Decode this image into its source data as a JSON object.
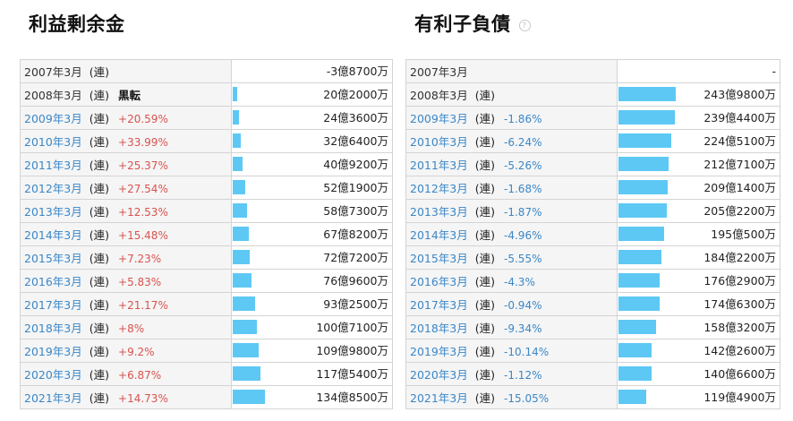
{
  "left": {
    "title": "利益剰余金",
    "rows": [
      {
        "period": "2007年3月",
        "cons": "(連)",
        "change": "",
        "change_dir": "",
        "value": "-3億8700万",
        "amount": -3.87
      },
      {
        "period": "2008年3月",
        "cons": "(連)",
        "change": "黒転",
        "change_dir": "bold",
        "value": "20億2000万",
        "amount": 20.2
      },
      {
        "period": "2009年3月",
        "cons": "(連)",
        "change": "+20.59%",
        "change_dir": "up",
        "value": "24億3600万",
        "amount": 24.36
      },
      {
        "period": "2010年3月",
        "cons": "(連)",
        "change": "+33.99%",
        "change_dir": "up",
        "value": "32億6400万",
        "amount": 32.64
      },
      {
        "period": "2011年3月",
        "cons": "(連)",
        "change": "+25.37%",
        "change_dir": "up",
        "value": "40億9200万",
        "amount": 40.92
      },
      {
        "period": "2012年3月",
        "cons": "(連)",
        "change": "+27.54%",
        "change_dir": "up",
        "value": "52億1900万",
        "amount": 52.19
      },
      {
        "period": "2013年3月",
        "cons": "(連)",
        "change": "+12.53%",
        "change_dir": "up",
        "value": "58億7300万",
        "amount": 58.73
      },
      {
        "period": "2014年3月",
        "cons": "(連)",
        "change": "+15.48%",
        "change_dir": "up",
        "value": "67億8200万",
        "amount": 67.82
      },
      {
        "period": "2015年3月",
        "cons": "(連)",
        "change": "+7.23%",
        "change_dir": "up",
        "value": "72億7200万",
        "amount": 72.72
      },
      {
        "period": "2016年3月",
        "cons": "(連)",
        "change": "+5.83%",
        "change_dir": "up",
        "value": "76億9600万",
        "amount": 76.96
      },
      {
        "period": "2017年3月",
        "cons": "(連)",
        "change": "+21.17%",
        "change_dir": "up",
        "value": "93億2500万",
        "amount": 93.25
      },
      {
        "period": "2018年3月",
        "cons": "(連)",
        "change": "+8%",
        "change_dir": "up",
        "value": "100億7100万",
        "amount": 100.71
      },
      {
        "period": "2019年3月",
        "cons": "(連)",
        "change": "+9.2%",
        "change_dir": "up",
        "value": "109億9800万",
        "amount": 109.98
      },
      {
        "period": "2020年3月",
        "cons": "(連)",
        "change": "+6.87%",
        "change_dir": "up",
        "value": "117億5400万",
        "amount": 117.54
      },
      {
        "period": "2021年3月",
        "cons": "(連)",
        "change": "+14.73%",
        "change_dir": "up",
        "value": "134億8500万",
        "amount": 134.85
      }
    ]
  },
  "right": {
    "title": "有利子負債",
    "help_icon": "question-circle-icon",
    "help_glyph": "?",
    "rows": [
      {
        "period": "2007年3月",
        "cons": "",
        "change": "",
        "change_dir": "",
        "value": "-",
        "amount": 0
      },
      {
        "period": "2008年3月",
        "cons": "(連)",
        "change": "",
        "change_dir": "",
        "value": "243億9800万",
        "amount": 243.98
      },
      {
        "period": "2009年3月",
        "cons": "(連)",
        "change": "-1.86%",
        "change_dir": "down",
        "value": "239億4400万",
        "amount": 239.44
      },
      {
        "period": "2010年3月",
        "cons": "(連)",
        "change": "-6.24%",
        "change_dir": "down",
        "value": "224億5100万",
        "amount": 224.51
      },
      {
        "period": "2011年3月",
        "cons": "(連)",
        "change": "-5.26%",
        "change_dir": "down",
        "value": "212億7100万",
        "amount": 212.71
      },
      {
        "period": "2012年3月",
        "cons": "(連)",
        "change": "-1.68%",
        "change_dir": "down",
        "value": "209億1400万",
        "amount": 209.14
      },
      {
        "period": "2013年3月",
        "cons": "(連)",
        "change": "-1.87%",
        "change_dir": "down",
        "value": "205億2200万",
        "amount": 205.22
      },
      {
        "period": "2014年3月",
        "cons": "(連)",
        "change": "-4.96%",
        "change_dir": "down",
        "value": "195億500万",
        "amount": 195.05
      },
      {
        "period": "2015年3月",
        "cons": "(連)",
        "change": "-5.55%",
        "change_dir": "down",
        "value": "184億2200万",
        "amount": 184.22
      },
      {
        "period": "2016年3月",
        "cons": "(連)",
        "change": "-4.3%",
        "change_dir": "down",
        "value": "176億2900万",
        "amount": 176.29
      },
      {
        "period": "2017年3月",
        "cons": "(連)",
        "change": "-0.94%",
        "change_dir": "down",
        "value": "174億6300万",
        "amount": 174.63
      },
      {
        "period": "2018年3月",
        "cons": "(連)",
        "change": "-9.34%",
        "change_dir": "down",
        "value": "158億3200万",
        "amount": 158.32
      },
      {
        "period": "2019年3月",
        "cons": "(連)",
        "change": "-10.14%",
        "change_dir": "down",
        "value": "142億2600万",
        "amount": 142.26
      },
      {
        "period": "2020年3月",
        "cons": "(連)",
        "change": "-1.12%",
        "change_dir": "down",
        "value": "140億6600万",
        "amount": 140.66
      },
      {
        "period": "2021年3月",
        "cons": "(連)",
        "change": "-15.05%",
        "change_dir": "down",
        "value": "119億4900万",
        "amount": 119.49
      }
    ]
  },
  "colors": {
    "bar": "#5ec8f5",
    "link": "#3a87c8",
    "increase": "#d9534f",
    "decrease": "#3a87c8"
  }
}
